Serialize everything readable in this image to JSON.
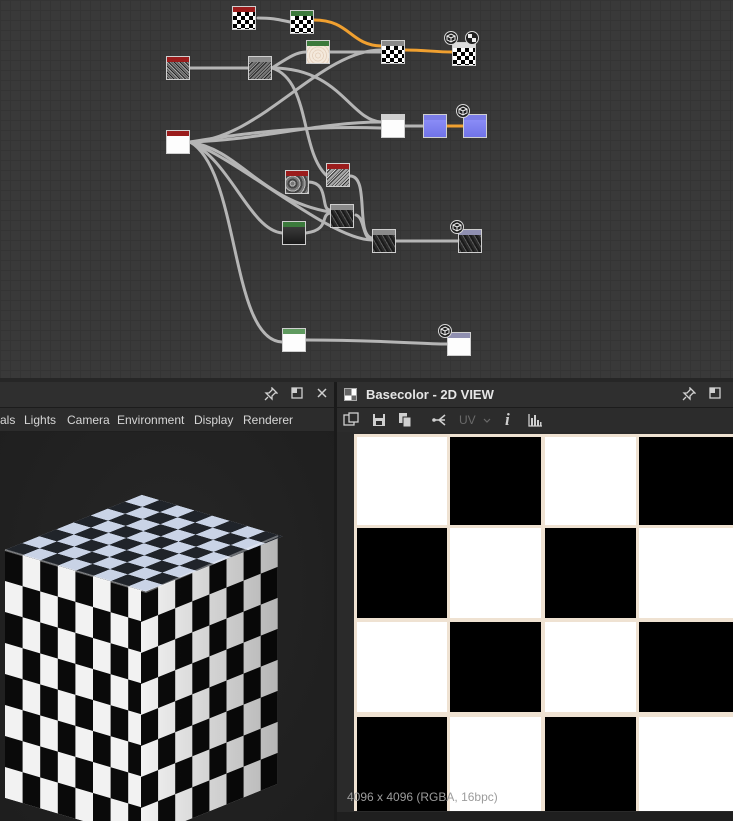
{
  "graph": {
    "output_icon": "cube-output-icon"
  },
  "left_panel": {
    "menu": [
      "als",
      "Lights",
      "Camera",
      "Environment",
      "Display",
      "Renderer"
    ],
    "buttons": {
      "pin": "pin-icon",
      "float": "float-icon",
      "close": "close-icon"
    }
  },
  "right_panel": {
    "title": "Basecolor - 2D VIEW",
    "toolbar": {
      "uv_label": "UV",
      "info_label": "i"
    },
    "resolution": "4096 x 4096 (RGBA, 16bpc)"
  },
  "colors": {
    "graph_bg": "#393939",
    "edge_gray": "#b5b5b5",
    "edge_orange": "#f0a030",
    "node_red": "#9b1c1c",
    "node_green": "#3c7a3c",
    "node_blue": "#7b7de8"
  }
}
